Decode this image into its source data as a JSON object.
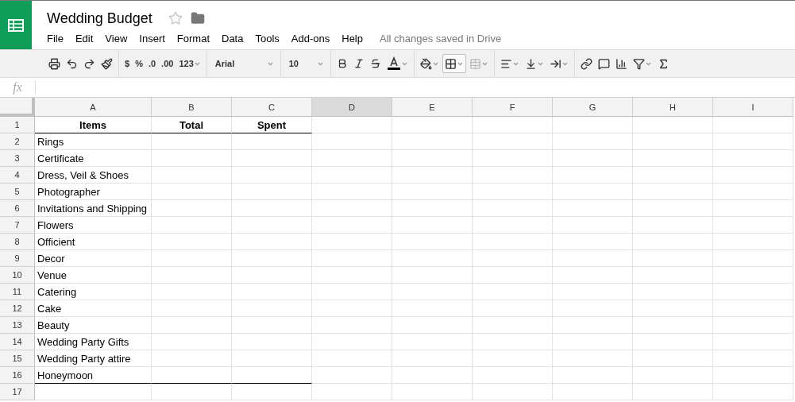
{
  "document": {
    "title": "Wedding Budget",
    "starred": false
  },
  "menu": [
    "File",
    "Edit",
    "View",
    "Insert",
    "Format",
    "Data",
    "Tools",
    "Add-ons",
    "Help"
  ],
  "save_status": "All changes saved in Drive",
  "toolbar": {
    "currency": "$",
    "percent": "%",
    "decrease_decimals": ".0",
    "increase_decimals": ".00",
    "number_format": "123",
    "font": "Arial",
    "font_size": "10",
    "borders_pressed": true,
    "merge_disabled": true
  },
  "formula_bar": {
    "label": "fx"
  },
  "columns": [
    {
      "label": "A",
      "selected": false
    },
    {
      "label": "B",
      "selected": false
    },
    {
      "label": "C",
      "selected": false
    },
    {
      "label": "D",
      "selected": true
    },
    {
      "label": "E",
      "selected": false
    },
    {
      "label": "F",
      "selected": false
    },
    {
      "label": "G",
      "selected": false
    },
    {
      "label": "H",
      "selected": false
    },
    {
      "label": "I",
      "selected": false
    }
  ],
  "rows": [
    {
      "number": "1",
      "kind": "heading",
      "underlined": true,
      "cells": [
        "Items",
        "Total",
        "Spent"
      ]
    },
    {
      "number": "2",
      "kind": "item",
      "underlined": false,
      "cells": [
        "Rings"
      ]
    },
    {
      "number": "3",
      "kind": "item",
      "underlined": false,
      "cells": [
        "Certificate"
      ]
    },
    {
      "number": "4",
      "kind": "item",
      "underlined": false,
      "cells": [
        "Dress, Veil & Shoes"
      ]
    },
    {
      "number": "5",
      "kind": "item",
      "underlined": false,
      "cells": [
        "Photographer"
      ]
    },
    {
      "number": "6",
      "kind": "item",
      "underlined": false,
      "cells": [
        "Invitations and Shipping"
      ]
    },
    {
      "number": "7",
      "kind": "item",
      "underlined": false,
      "cells": [
        "Flowers"
      ]
    },
    {
      "number": "8",
      "kind": "item",
      "underlined": false,
      "cells": [
        "Officient"
      ]
    },
    {
      "number": "9",
      "kind": "item",
      "underlined": false,
      "cells": [
        "Decor"
      ]
    },
    {
      "number": "10",
      "kind": "item",
      "underlined": false,
      "cells": [
        "Venue"
      ]
    },
    {
      "number": "11",
      "kind": "item",
      "underlined": false,
      "cells": [
        "Catering"
      ]
    },
    {
      "number": "12",
      "kind": "item",
      "underlined": false,
      "cells": [
        "Cake"
      ]
    },
    {
      "number": "13",
      "kind": "item",
      "underlined": false,
      "cells": [
        "Beauty"
      ]
    },
    {
      "number": "14",
      "kind": "item",
      "underlined": false,
      "cells": [
        "Wedding Party Gifts"
      ]
    },
    {
      "number": "15",
      "kind": "item",
      "underlined": false,
      "cells": [
        "Wedding Party attire"
      ]
    },
    {
      "number": "16",
      "kind": "item",
      "underlined": true,
      "cells": [
        "Honeymoon"
      ]
    },
    {
      "number": "17",
      "kind": "item",
      "underlined": false
    }
  ]
}
